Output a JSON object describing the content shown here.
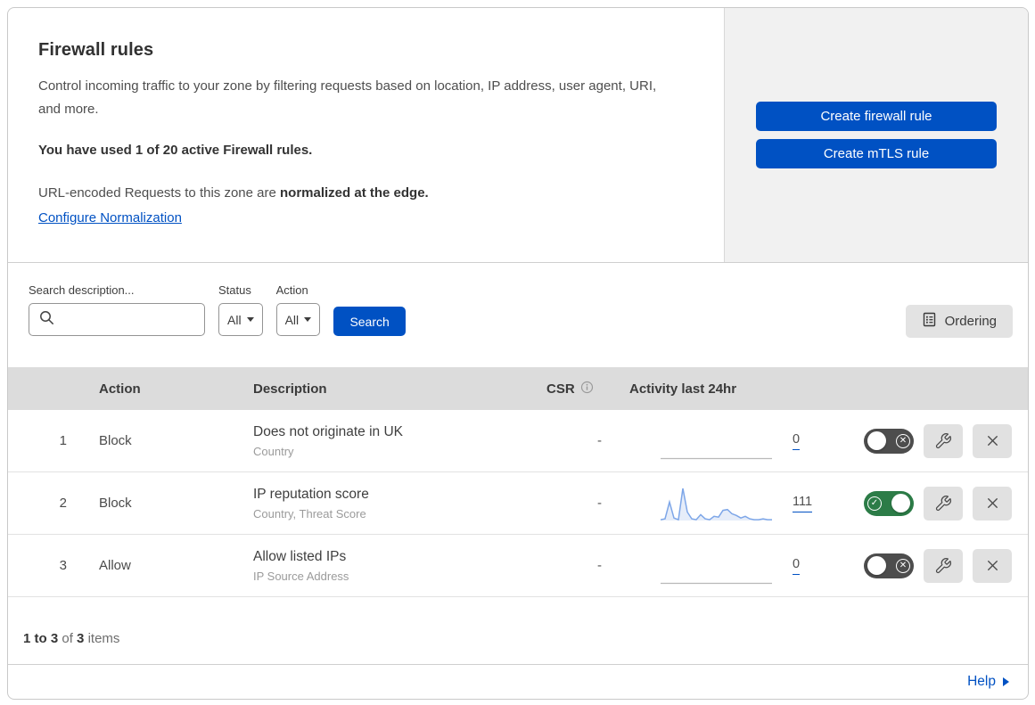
{
  "hero": {
    "title": "Firewall rules",
    "description": "Control incoming traffic to your zone by filtering requests based on location, IP address, user agent, URI, and more.",
    "usage": "You have used 1 of 20 active Firewall rules.",
    "normalization_text": "URL-encoded Requests to this zone are ",
    "normalization_bold": "normalized at the edge.",
    "normalization_link": "Configure Normalization",
    "create_firewall_rule_label": "Create firewall rule",
    "create_mtls_rule_label": "Create mTLS rule"
  },
  "filters": {
    "search_label": "Search description...",
    "search_value": "",
    "status_label": "Status",
    "status_value": "All",
    "action_label": "Action",
    "action_value": "All",
    "search_button_label": "Search",
    "ordering_button_label": "Ordering"
  },
  "table": {
    "headers": {
      "action": "Action",
      "description": "Description",
      "csr": "CSR",
      "activity": "Activity last 24hr"
    },
    "rows": [
      {
        "priority": "1",
        "action": "Block",
        "description": "Does not originate in UK",
        "fields": "Country",
        "csr": "-",
        "activity_count": "0",
        "enabled": false,
        "sparkline": null
      },
      {
        "priority": "2",
        "action": "Block",
        "description": "IP reputation score",
        "fields": "Country, Threat Score",
        "csr": "-",
        "activity_count": "111",
        "enabled": true,
        "sparkline": [
          1,
          2,
          22,
          3,
          1,
          38,
          10,
          2,
          1,
          7,
          2,
          1,
          5,
          4,
          12,
          13,
          8,
          6,
          3,
          5,
          2,
          1,
          1,
          2,
          1,
          1
        ]
      },
      {
        "priority": "3",
        "action": "Allow",
        "description": "Allow listed IPs",
        "fields": "IP Source Address",
        "csr": "-",
        "activity_count": "0",
        "enabled": false,
        "sparkline": null
      }
    ]
  },
  "footer": {
    "range": "1 to 3",
    "of": "of",
    "total": "3",
    "items": "items",
    "help_label": "Help"
  },
  "colors": {
    "primary_blue": "#0051c3",
    "toggle_on_green": "#2c7c47",
    "toggle_off_gray": "#4d4d4d",
    "sparkline_stroke": "#7da6e8",
    "sparkline_fill": "#e6edf9",
    "table_header_bg": "#dcdcdc",
    "panel_gray": "#f1f1f1"
  }
}
